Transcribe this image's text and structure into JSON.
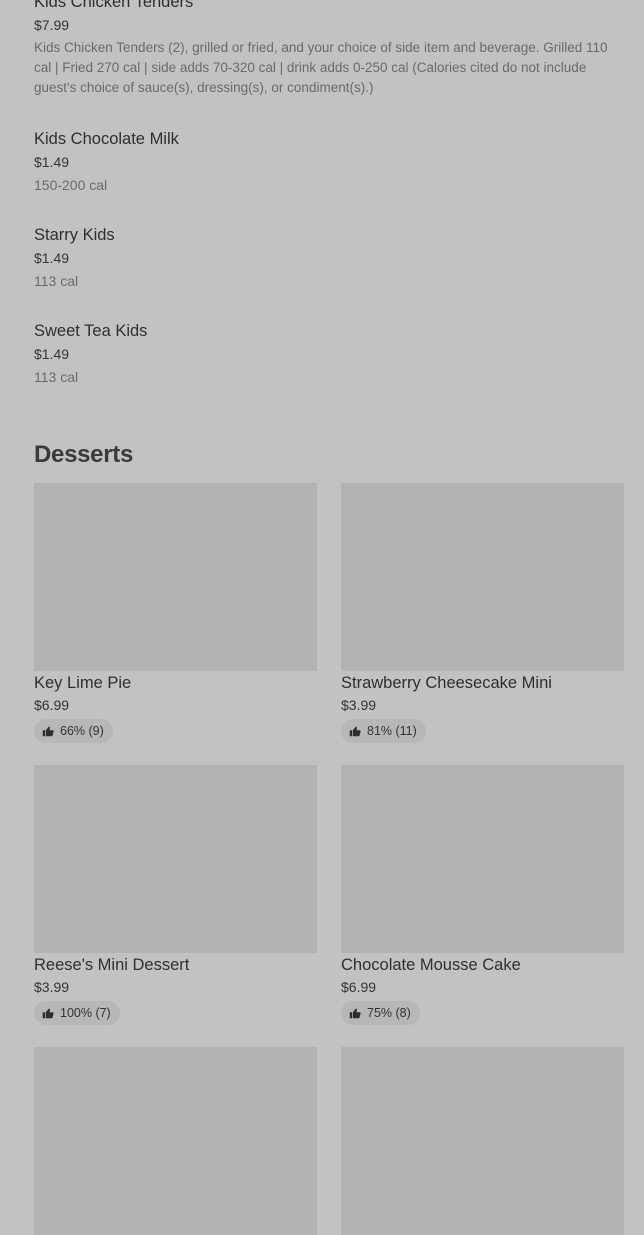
{
  "kids_items": [
    {
      "name": "Kids Chicken Tenders",
      "price": "$7.99",
      "desc": "Kids Chicken Tenders (2), grilled or fried, and your choice of side item and beverage. Grilled 110 cal | Fried 270 cal | side adds 70-320 cal | drink adds 0-250 cal (Calories cited do not include guest's choice of sauce(s), dressing(s), or condiment(s).)"
    },
    {
      "name": "Kids Chocolate Milk",
      "price": "$1.49",
      "cal": "150-200 cal"
    },
    {
      "name": "Starry Kids",
      "price": "$1.49",
      "cal": "113 cal"
    },
    {
      "name": "Sweet Tea Kids",
      "price": "$1.49",
      "cal": "113 cal"
    }
  ],
  "desserts": {
    "title": "Desserts",
    "items": [
      {
        "name": "Key Lime Pie",
        "price": "$6.99",
        "rating": "66% (9)"
      },
      {
        "name": "Strawberry Cheesecake Mini",
        "price": "$3.99",
        "rating": "81% (11)"
      },
      {
        "name": "Reese's Mini Dessert",
        "price": "$3.99",
        "rating": "100% (7)"
      },
      {
        "name": "Chocolate Mousse Cake",
        "price": "$6.99",
        "rating": "75% (8)"
      },
      {
        "name": "",
        "price": "",
        "rating": ""
      },
      {
        "name": "",
        "price": "",
        "rating": ""
      }
    ]
  },
  "icons": {
    "rating": "thumbs-up-icon",
    "image": "image-placeholder"
  },
  "colors": {
    "background": "#c2c2c2",
    "image_placeholder": "#b3b3b3",
    "rating_pill": "#b7b7b7"
  }
}
